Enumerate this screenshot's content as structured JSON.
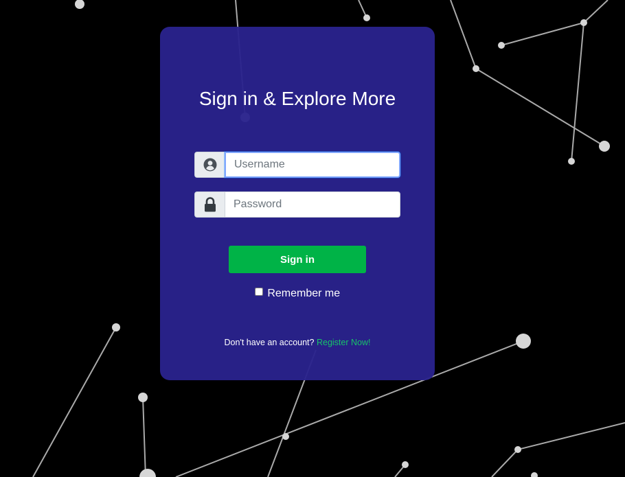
{
  "login": {
    "title": "Sign in & Explore More",
    "username_placeholder": "Username",
    "password_placeholder": "Password",
    "signin_label": "Sign in",
    "remember_label": "Remember me",
    "remember_checked": false,
    "no_account_text": "Don't have an account?",
    "register_link": "Register Now!"
  },
  "icons": {
    "username": "user-circle-icon",
    "password": "lock-icon"
  },
  "colors": {
    "background": "#000000",
    "card": "#2a228c",
    "signin_button": "#00b347",
    "register_link": "#17c26a"
  }
}
